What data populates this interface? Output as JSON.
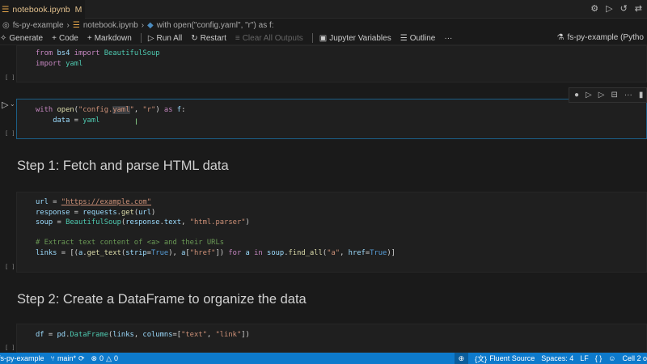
{
  "title_bar": {
    "tab_label": "notebook.ipynb",
    "tab_status": "M",
    "icons": [
      "gear-icon",
      "run-icon",
      "history-icon",
      "compare-icon"
    ]
  },
  "breadcrumb": {
    "items": [
      "fs-py-example",
      "notebook.ipynb",
      "with open(\"config.yaml\", \"r\") as f:"
    ]
  },
  "toolbar": {
    "generate": "Generate",
    "code": "Code",
    "markdown": "Markdown",
    "run_all": "Run All",
    "restart": "Restart",
    "clear_all": "Clear All Outputs",
    "variables": "Jupyter Variables",
    "outline": "Outline",
    "more": "···",
    "kernel": "fs-py-example (Pytho"
  },
  "cells": [
    {
      "type": "code",
      "bracket": "[ ]",
      "lines": [
        [
          [
            "from ",
            "k"
          ],
          [
            "bs4 ",
            "v"
          ],
          [
            "import ",
            "k"
          ],
          [
            "BeautifulSoup",
            "c"
          ]
        ],
        [
          [
            "import ",
            "k"
          ],
          [
            "yaml",
            "c"
          ]
        ]
      ]
    },
    {
      "type": "code",
      "bracket": "[ ]",
      "selected": true,
      "lines": [
        [
          [
            "with ",
            "k"
          ],
          [
            "open",
            "f"
          ],
          [
            "(",
            "p"
          ],
          [
            "\"config.",
            "s"
          ],
          [
            "yaml",
            "s hl"
          ],
          [
            "\"",
            "s"
          ],
          [
            ", ",
            "p"
          ],
          [
            "\"r\"",
            "s"
          ],
          [
            ") ",
            "p"
          ],
          [
            "as ",
            "k"
          ],
          [
            "f",
            "v"
          ],
          [
            ":",
            "p"
          ]
        ],
        [
          [
            "    ",
            "p"
          ],
          [
            "data",
            "v"
          ],
          [
            " = ",
            "p"
          ],
          [
            "yaml",
            "c"
          ]
        ]
      ]
    },
    {
      "type": "markdown",
      "text": "Step 1: Fetch and parse HTML data"
    },
    {
      "type": "code",
      "bracket": "[ ]",
      "lines": [
        [
          [
            "url",
            "v"
          ],
          [
            " = ",
            "p"
          ],
          [
            "\"https://example.com\"",
            "s ul"
          ]
        ],
        [
          [
            "response",
            "v"
          ],
          [
            " = ",
            "p"
          ],
          [
            "requests",
            "v"
          ],
          [
            ".",
            "p"
          ],
          [
            "get",
            "f"
          ],
          [
            "(",
            "p"
          ],
          [
            "url",
            "v"
          ],
          [
            ")",
            "p"
          ]
        ],
        [
          [
            "soup",
            "v"
          ],
          [
            " = ",
            "p"
          ],
          [
            "BeautifulSoup",
            "c"
          ],
          [
            "(",
            "p"
          ],
          [
            "response",
            "v"
          ],
          [
            ".",
            "p"
          ],
          [
            "text",
            "v"
          ],
          [
            ", ",
            "p"
          ],
          [
            "\"html.parser\"",
            "s"
          ],
          [
            ")",
            "p"
          ]
        ],
        [],
        [
          [
            "# Extract text content of <a> and their URLs",
            "cm"
          ]
        ],
        [
          [
            "links",
            "v"
          ],
          [
            " = ",
            "p"
          ],
          [
            "[(",
            "p"
          ],
          [
            "a",
            "v"
          ],
          [
            ".",
            "p"
          ],
          [
            "get_text",
            "f"
          ],
          [
            "(",
            "p"
          ],
          [
            "strip",
            "v"
          ],
          [
            "=",
            "p"
          ],
          [
            "True",
            "bo"
          ],
          [
            "), ",
            "p"
          ],
          [
            "a",
            "v"
          ],
          [
            "[",
            "p"
          ],
          [
            "\"href\"",
            "s"
          ],
          [
            "]) ",
            "p"
          ],
          [
            "for ",
            "k"
          ],
          [
            "a ",
            "v"
          ],
          [
            "in ",
            "k"
          ],
          [
            "soup",
            "v"
          ],
          [
            ".",
            "p"
          ],
          [
            "find_all",
            "f"
          ],
          [
            "(",
            "p"
          ],
          [
            "\"a\"",
            "s"
          ],
          [
            ", ",
            "p"
          ],
          [
            "href",
            "v"
          ],
          [
            "=",
            "p"
          ],
          [
            "True",
            "bo"
          ],
          [
            ")]",
            "p"
          ]
        ]
      ]
    },
    {
      "type": "markdown",
      "text": "Step 2: Create a DataFrame to organize the data"
    },
    {
      "type": "code",
      "bracket": "[ ]",
      "lines": [
        [
          [
            "df",
            "v"
          ],
          [
            " = ",
            "p"
          ],
          [
            "pd",
            "v"
          ],
          [
            ".",
            "p"
          ],
          [
            "DataFrame",
            "c"
          ],
          [
            "(",
            "p"
          ],
          [
            "links",
            "v"
          ],
          [
            ", ",
            "p"
          ],
          [
            "columns",
            "v"
          ],
          [
            "=[",
            "p"
          ],
          [
            "\"text\"",
            "s"
          ],
          [
            ", ",
            "p"
          ],
          [
            "\"link\"",
            "s"
          ],
          [
            "])",
            "p"
          ]
        ]
      ]
    }
  ],
  "status_bar": {
    "folder": "fs-py-example",
    "branch": "main*",
    "errors": "0",
    "warnings": "0",
    "language": "Fluent Source",
    "spaces": "Spaces: 4",
    "eol": "LF",
    "braces": "{ }",
    "cell": "Cell 2 o"
  },
  "colors": {
    "accent": "#0d7acc",
    "selected_border": "#1b5e86"
  }
}
